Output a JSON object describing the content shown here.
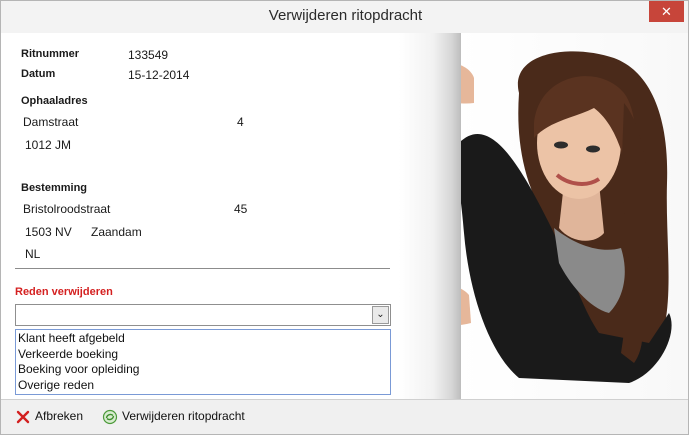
{
  "window": {
    "title": "Verwijderen ritopdracht",
    "close_label": "✕"
  },
  "ride": {
    "ritnummer_label": "Ritnummer",
    "ritnummer": "133549",
    "datum_label": "Datum",
    "datum": "15-12-2014"
  },
  "ophaal": {
    "label": "Ophaaladres",
    "straat": "Damstraat",
    "huisnummer": "4",
    "postcode": "1012 JM"
  },
  "bestemming": {
    "label": "Bestemming",
    "straat": "Bristolroodstraat",
    "huisnummer": "45",
    "postcode": "1503 NV",
    "plaats": "Zaandam",
    "land": "NL"
  },
  "reden": {
    "label": "Reden verwijderen",
    "value": "",
    "options": [
      "Klant heeft afgebeld",
      "Verkeerde boeking",
      "Boeking voor opleiding",
      "Overige reden"
    ]
  },
  "toolbar": {
    "cancel_label": "Afbreken",
    "delete_label": "Verwijderen ritopdracht"
  },
  "colors": {
    "close_button": "#c7453a",
    "reden_label": "#d42020",
    "dropdown_border": "#7a9ad6"
  }
}
